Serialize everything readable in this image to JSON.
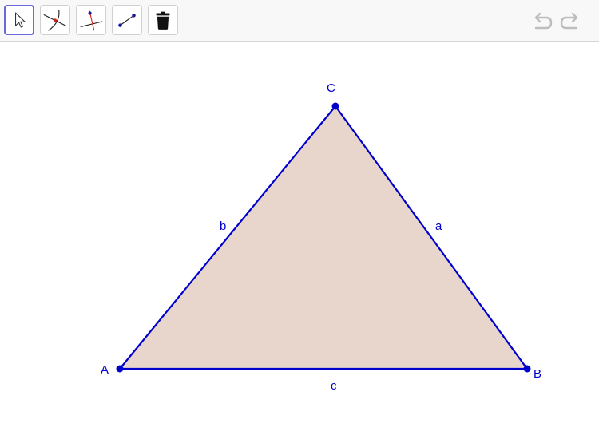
{
  "toolbar": {
    "tools": [
      {
        "id": "move",
        "icon": "move-arrow-icon",
        "active": true
      },
      {
        "id": "intersect",
        "icon": "intersect-icon",
        "active": false
      },
      {
        "id": "perpendicular",
        "icon": "perpendicular-line-icon",
        "active": false
      },
      {
        "id": "segment",
        "icon": "segment-icon",
        "active": false
      },
      {
        "id": "delete",
        "icon": "trash-icon",
        "active": false
      }
    ],
    "undo_icon": "undo-icon",
    "redo_icon": "redo-icon"
  },
  "construction": {
    "points": {
      "A": {
        "label": "A"
      },
      "B": {
        "label": "B"
      },
      "C": {
        "label": "C"
      }
    },
    "segments": {
      "a": {
        "label": "a"
      },
      "b": {
        "label": "b"
      },
      "c": {
        "label": "c"
      }
    },
    "colors": {
      "stroke": "#0000cc",
      "fill": "#e8d6cc",
      "point": "#0000cc"
    }
  }
}
